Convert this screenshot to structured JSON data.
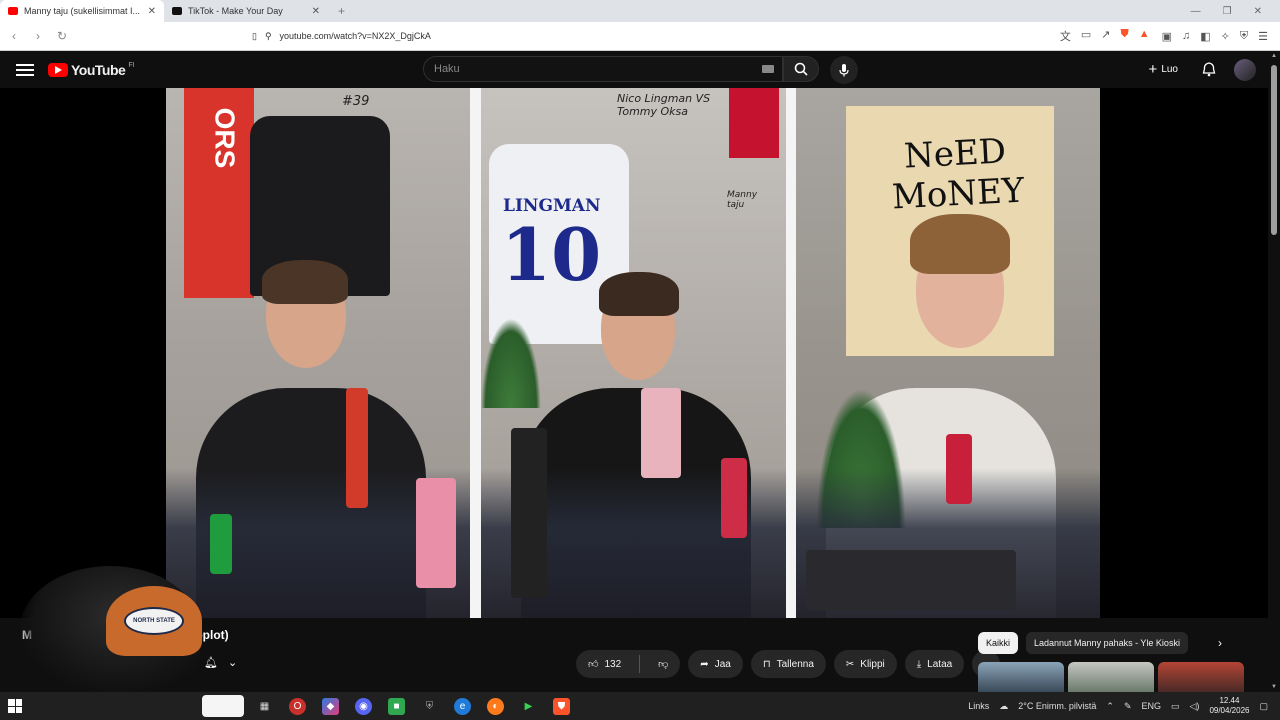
{
  "browser": {
    "tabs": [
      {
        "title": "Manny taju (sukellisimmat I...",
        "favicon_color": "#ff0000",
        "active": true
      },
      {
        "title": "TikTok - Make Your Day",
        "favicon_color": "#111111",
        "active": false
      }
    ],
    "new_tab": "+",
    "url": "youtube.com/watch?v=NX2X_DgjCkA"
  },
  "youtube": {
    "logo_text": "YouTube",
    "country_code": "FI",
    "search_placeholder": "Haku",
    "create_label": "Luo"
  },
  "video": {
    "poster_text_line1": "NeED",
    "poster_text_line2": "MoNEY",
    "jersey_name": "LINGMAN",
    "jersey_number": "10",
    "wall_note": "Nico Lingman VS Tommy Oksa",
    "side_note": "Manny taju",
    "flag_text": "ORS",
    "poster_number": "#39"
  },
  "below_video": {
    "title_fragment_left": "M",
    "title_fragment_right": "pplot)",
    "likes_count": "132",
    "share_label": "Jaa",
    "save_label": "Tallenna",
    "clip_label": "Klippi",
    "download_label": "Lataa"
  },
  "sidebar_chips": [
    {
      "label": "Kaikki",
      "active": true
    },
    {
      "label": "Ladannut Manny pahaks - Yle Kioski",
      "active": false
    }
  ],
  "taskbar": {
    "links_label": "Links",
    "weather": "2°C  Enimm. pilvistä",
    "language": "ENG",
    "time": "12.44",
    "date": "09/04/2026"
  },
  "colors": {
    "yt_red": "#ff0000",
    "bg": "#0f0f0f",
    "pill_bg": "#272727",
    "taskbar": "#202020"
  }
}
